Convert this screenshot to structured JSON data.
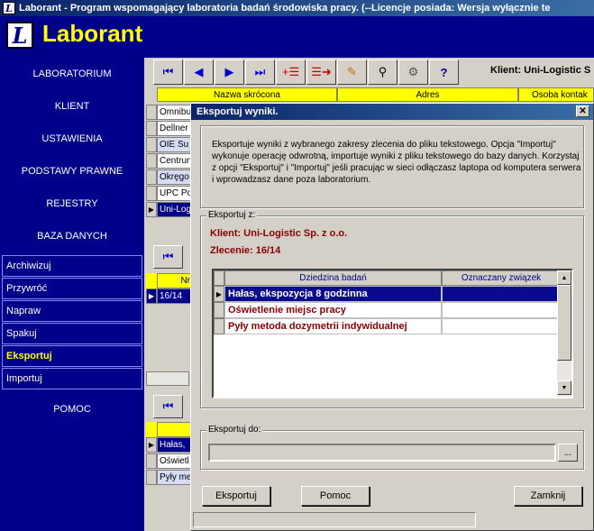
{
  "window": {
    "title": "Laborant - Program wspomagający laboratoria badań środowiska pracy.  (--Licencje posiada: Wersja wyłącznie te",
    "app_name": "Laborant",
    "logo_letter": "L"
  },
  "sidebar": {
    "items": [
      {
        "label": "LABORATORIUM"
      },
      {
        "label": "KLIENT"
      },
      {
        "label": "USTAWIENIA"
      },
      {
        "label": "PODSTAWY PRAWNE"
      },
      {
        "label": "REJESTRY"
      },
      {
        "label": "BAZA DANYCH"
      }
    ],
    "subitems": [
      {
        "label": "Archiwizuj"
      },
      {
        "label": "Przywróć"
      },
      {
        "label": "Napraw"
      },
      {
        "label": "Spakuj"
      },
      {
        "label": "Eksportuj",
        "active": true
      },
      {
        "label": "Importuj"
      }
    ],
    "help_label": "POMOC"
  },
  "toolbar": {
    "client_label": "Klient: Uni-Logistic S"
  },
  "bg_grid": {
    "columns": [
      "Nazwa skrócona",
      "Adres",
      "Osoba kontak"
    ],
    "rows": [
      "Omnibu",
      "Dellner",
      "OIE Su",
      "Centrun",
      "Okręgo",
      "UPC Po",
      "Uni-Log"
    ]
  },
  "bg_grid2": {
    "col_fragment": "Nr",
    "row": "16/14"
  },
  "bg_grid3": {
    "rows": [
      "Hałas,",
      "Oświetl",
      "Pyły me"
    ]
  },
  "dialog": {
    "title": "Eksportuj wyniki.",
    "description": "Eksportuje wyniki z wybranego zakresy zlecenia do pliku tekstowego. Opcja \"Importuj\" wykonuje operację odwrotną, importuje wyniki z pliku tekstowego do bazy danych. Korzystaj z opcji \"Eksportuj\" i \"Importuj\" jeśli pracując w sieci odłączasz laptopa od komputera serwera i wprowadzasz dane poza laboratorium.",
    "export_from_label": "Eksportuj z:",
    "client_line": "Klient: Uni-Logistic Sp. z o.o.",
    "order_line": "Zlecenie: 16/14",
    "grid": {
      "columns": [
        "Dziedzina badań",
        "Oznaczany związek"
      ],
      "rows": [
        {
          "field": "Hałas, ekspozycja 8 godzinna",
          "compound": "",
          "selected": true
        },
        {
          "field": "Oświetlenie miejsc pracy",
          "compound": ""
        },
        {
          "field": "Pyły metoda dozymetrii indywidualnej",
          "compound": ""
        }
      ]
    },
    "export_to_label": "Eksportuj do:",
    "path_value": "",
    "browse_label": "...",
    "buttons": {
      "export": "Eksportuj",
      "help": "Pomoc",
      "close": "Zamknij"
    }
  }
}
